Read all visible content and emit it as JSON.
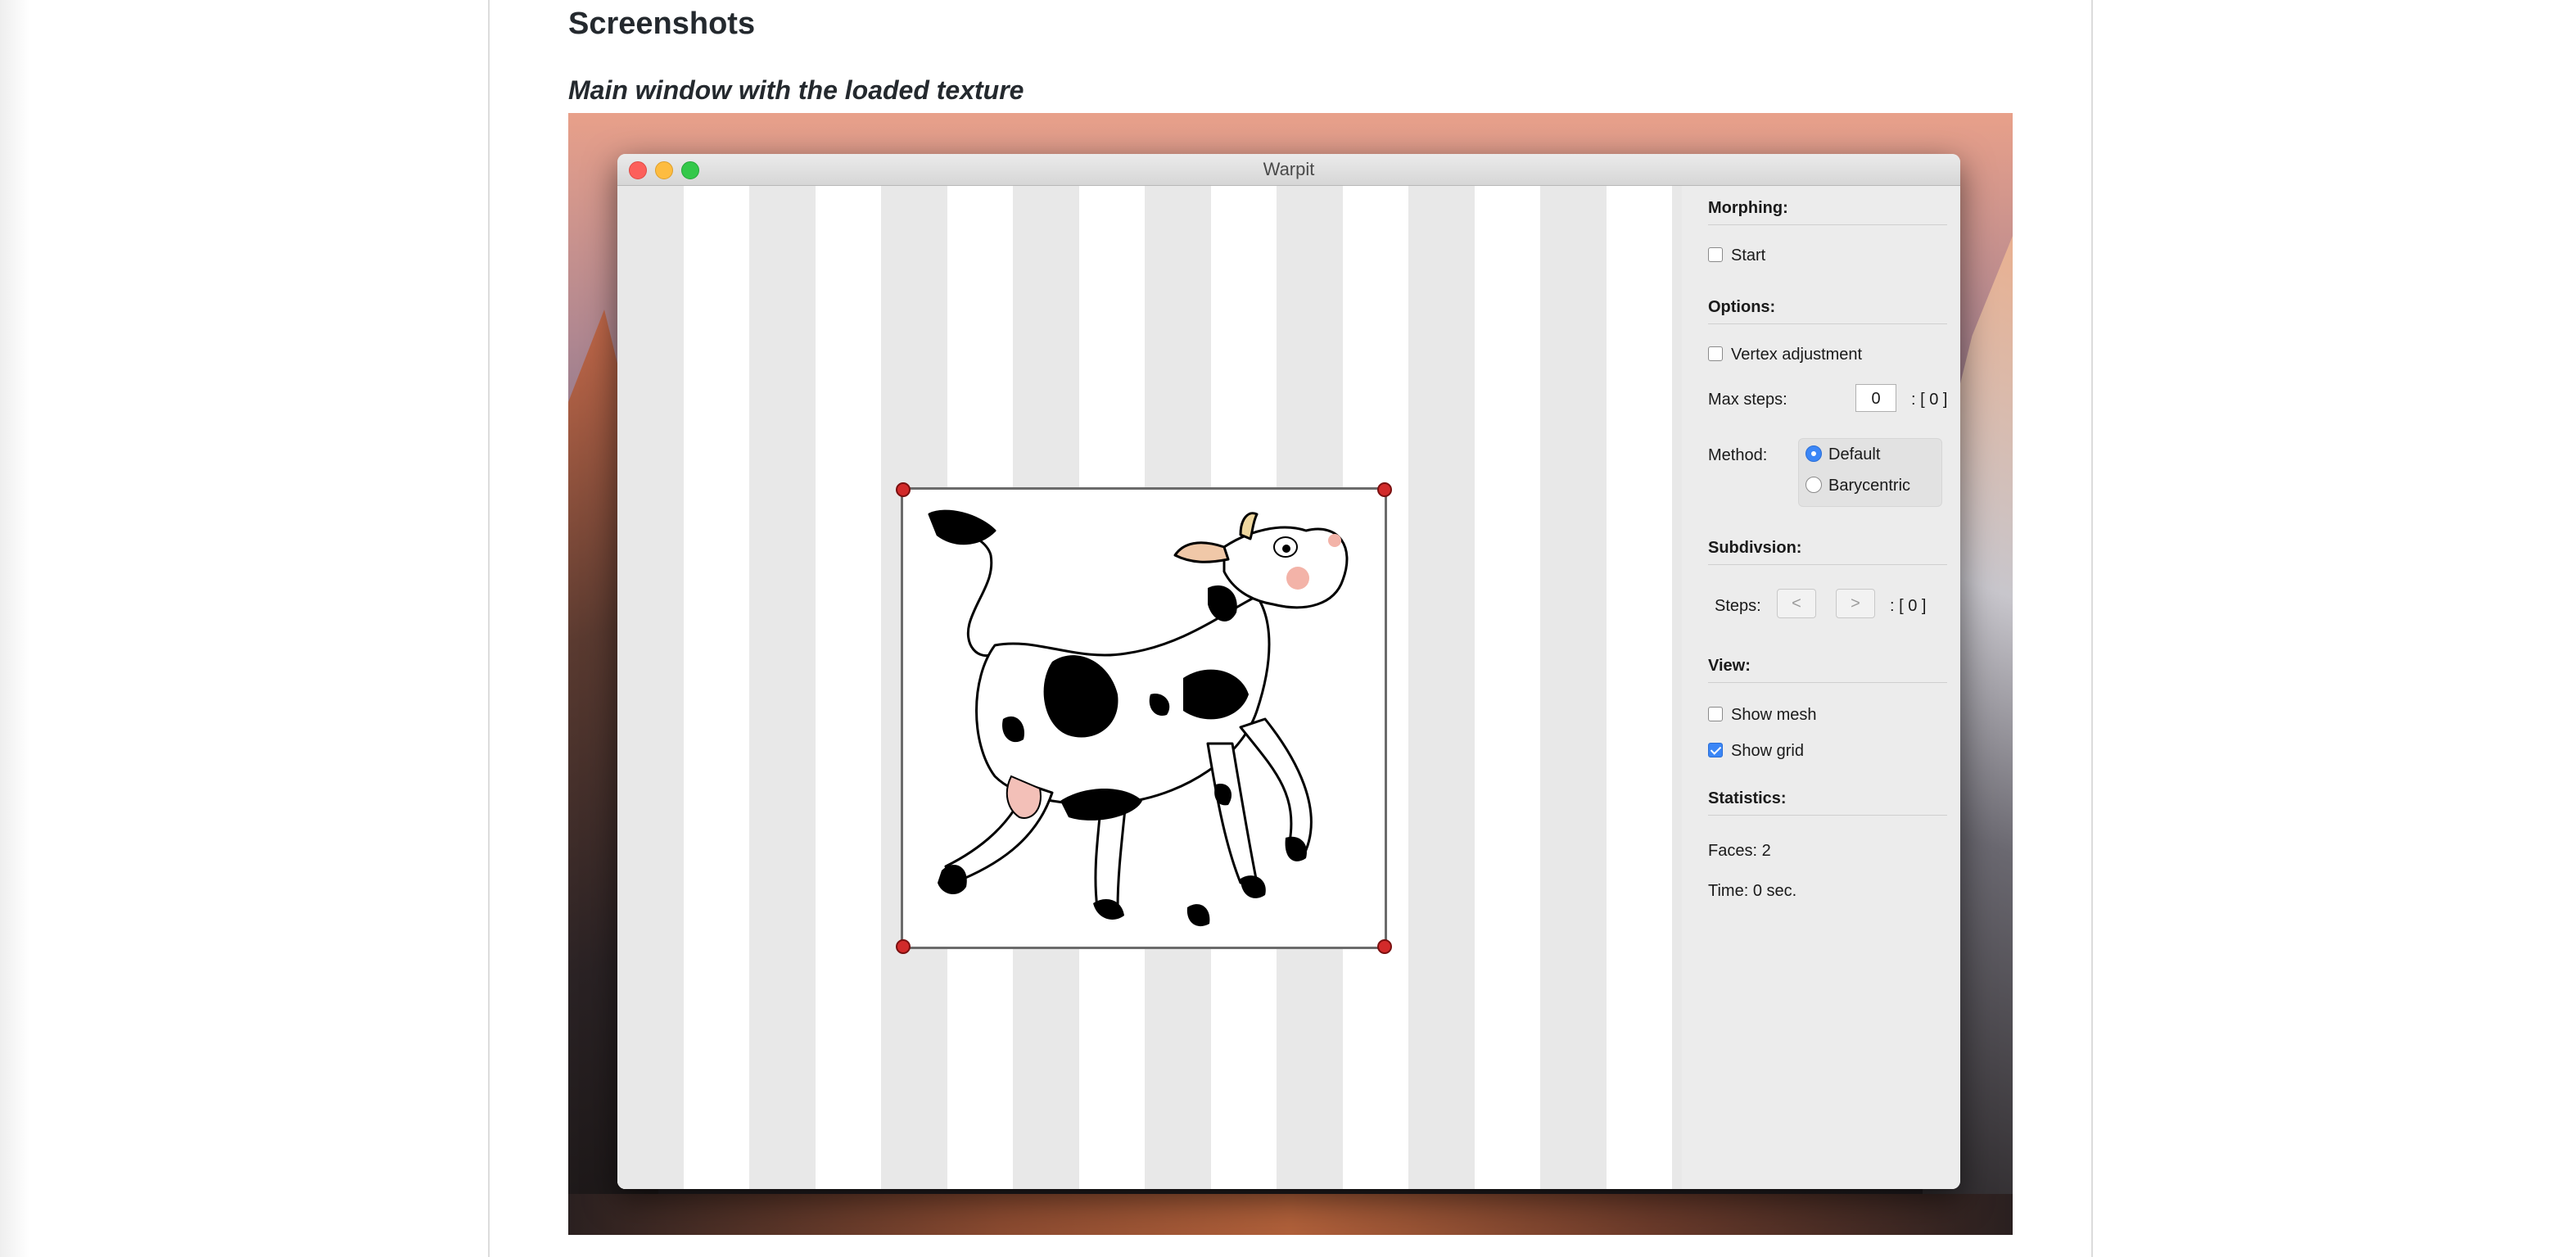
{
  "page": {
    "section_heading": "Screenshots",
    "caption": "Main window with the loaded texture"
  },
  "window": {
    "title": "Warpit"
  },
  "sidebar": {
    "morphing": {
      "title": "Morphing:",
      "start_label": "Start",
      "start_checked": false
    },
    "options": {
      "title": "Options:",
      "vertex_adjustment_label": "Vertex adjustment",
      "vertex_adjustment_checked": false,
      "max_steps_label": "Max steps:",
      "max_steps_value": "0",
      "max_steps_bracket": ": [ 0 ]",
      "method_label": "Method:",
      "method_options": [
        "Default",
        "Barycentric"
      ],
      "method_selected": "Default"
    },
    "subdivision": {
      "title": "Subdivsion:",
      "steps_label": "Steps:",
      "prev_label": "<",
      "next_label": ">",
      "steps_bracket": ": [ 0 ]"
    },
    "view": {
      "title": "View:",
      "show_mesh_label": "Show mesh",
      "show_mesh_checked": false,
      "show_grid_label": "Show grid",
      "show_grid_checked": true
    },
    "statistics": {
      "title": "Statistics:",
      "faces": "Faces: 2",
      "time": "Time: 0 sec."
    }
  },
  "colors": {
    "accent": "#3b86f6",
    "handle": "#d22a2a",
    "checker_dark": "#e8e8e8"
  },
  "icons": {
    "close": "window-close-icon",
    "minimize": "window-minimize-icon",
    "maximize": "window-maximize-icon"
  }
}
